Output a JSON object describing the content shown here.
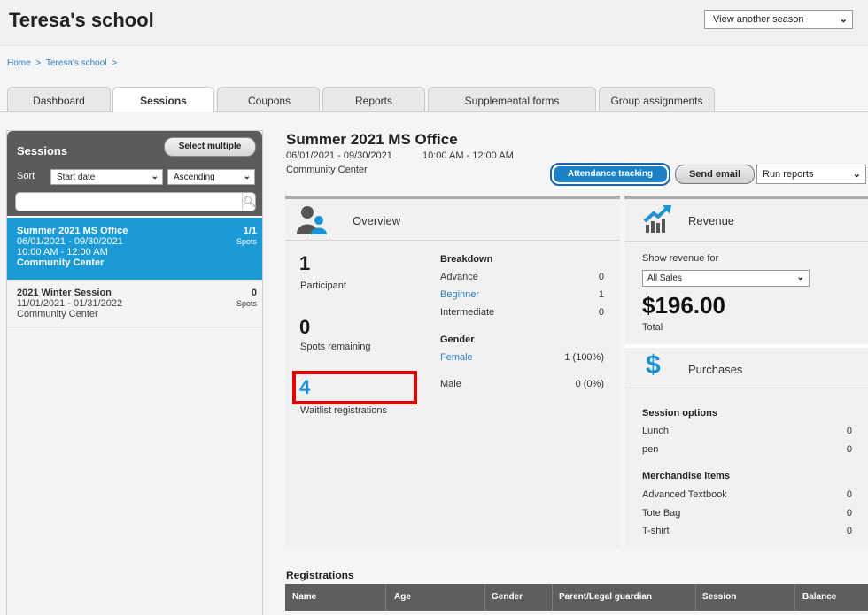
{
  "header": {
    "school_title": "Teresa's school",
    "season_select": "View another season"
  },
  "breadcrumb": [
    "Home",
    ">",
    "Teresa's school",
    ">"
  ],
  "tabs": [
    {
      "label": "Dashboard",
      "active": false
    },
    {
      "label": "Sessions",
      "active": true
    },
    {
      "label": "Coupons",
      "active": false
    },
    {
      "label": "Reports",
      "active": false
    },
    {
      "label": "Supplemental forms",
      "active": false
    },
    {
      "label": "Group assignments",
      "active": false
    }
  ],
  "sidebar": {
    "title": "Sessions",
    "select_multiple": "Select multiple",
    "sort_label": "Sort",
    "sort_field": "Start date",
    "sort_order": "Ascending",
    "search_placeholder": "",
    "sessions": [
      {
        "name": "Summer 2021 MS Office",
        "dates": "06/01/2021 - 09/30/2021",
        "time": "10:00 AM - 12:00 AM",
        "location": "Community Center",
        "count": "1/1",
        "spots_label": "Spots",
        "selected": true
      },
      {
        "name": "2021 Winter Session",
        "dates": "11/01/2021 - 01/31/2022",
        "location": "Community Center",
        "count": "0",
        "spots_label": "Spots",
        "selected": false
      }
    ]
  },
  "session": {
    "title": "Summer 2021 MS Office",
    "dates": "06/01/2021 - 09/30/2021",
    "time": "10:00 AM - 12:00 AM",
    "location": "Community Center",
    "attendance_button": "Attendance tracking",
    "send_email_button": "Send email",
    "run_reports": "Run reports"
  },
  "overview": {
    "title": "Overview",
    "participants": {
      "value": "1",
      "label": "Participant"
    },
    "spots_remaining": {
      "value": "0",
      "label": "Spots remaining"
    },
    "waitlist": {
      "value": "4",
      "label": "Waitlist registrations"
    },
    "breakdown_title": "Breakdown",
    "breakdown": [
      {
        "label": "Advance",
        "value": "0"
      },
      {
        "label": "Beginner",
        "value": "1"
      },
      {
        "label": "Intermediate",
        "value": "0"
      }
    ],
    "gender_title": "Gender",
    "gender": [
      {
        "label": "Female",
        "value": "1 (100%)"
      },
      {
        "label": "Male",
        "value": "0 (0%)"
      }
    ]
  },
  "revenue": {
    "title": "Revenue",
    "show_for_label": "Show revenue for",
    "filter": "All Sales",
    "amount": "$196.00",
    "total_label": "Total"
  },
  "purchases": {
    "title": "Purchases",
    "icon": "$",
    "session_options_title": "Session options",
    "session_options": [
      {
        "label": "Lunch",
        "value": "0"
      },
      {
        "label": "pen",
        "value": "0"
      }
    ],
    "merch_title": "Merchandise items",
    "merch": [
      {
        "label": "Advanced Textbook",
        "value": "0"
      },
      {
        "label": "Tote Bag",
        "value": "0"
      },
      {
        "label": "T-shirt",
        "value": "0"
      }
    ]
  },
  "registrations": {
    "title": "Registrations",
    "columns": [
      "Name",
      "Age",
      "Gender",
      "Parent/Legal guardian",
      "Session",
      "Balance"
    ]
  },
  "colors": {
    "accent_blue": "#1a9ad6",
    "highlight_red": "#e60000",
    "sidebar_header": "#5b5b5b"
  }
}
